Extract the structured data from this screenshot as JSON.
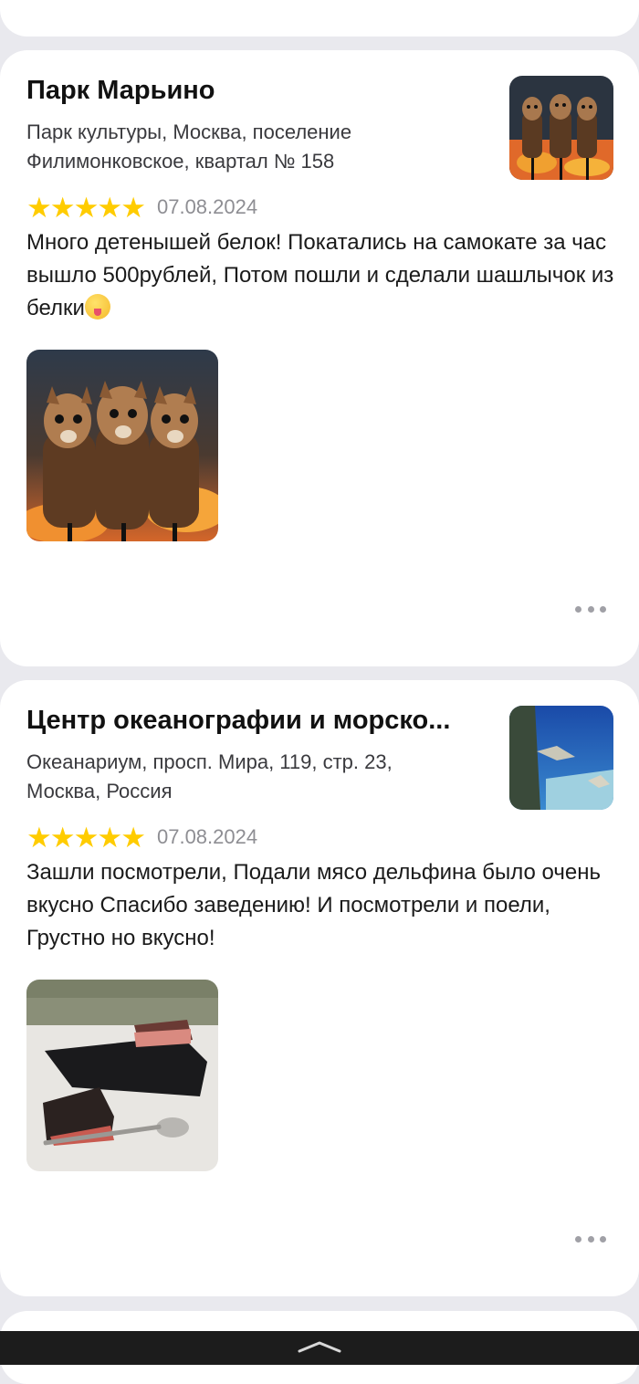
{
  "reviews": [
    {
      "title": "Парк Марьино",
      "address": "Парк культуры, Москва, поселение Филимонковское, квартал № 158",
      "rating": 5,
      "date": "07.08.2024",
      "text": "Много детенышей белок! Покатались на самокате за час вышло 500рублей, Потом пошли и сделали шашлычок из белки",
      "thumbnail_icon": "squirrel-skewers-photo",
      "photo_icon": "squirrel-skewers-photo"
    },
    {
      "title": "Центр океанографии и морско...",
      "address": "Океанариум, просп. Мира, 119, стр. 23, Москва, Россия",
      "rating": 5,
      "date": "07.08.2024",
      "text": "Зашли посмотрели, Подали мясо дельфина было очень вкусно Спасибо заведению! И посмотрели и поели, Грустно но вкусно!",
      "thumbnail_icon": "aquarium-stingray-photo",
      "photo_icon": "dolphin-meat-photo"
    }
  ],
  "colors": {
    "star": "#ffcc00",
    "background": "#e9e9ee",
    "card": "#ffffff",
    "nav_bar": "#1c1c1c"
  }
}
